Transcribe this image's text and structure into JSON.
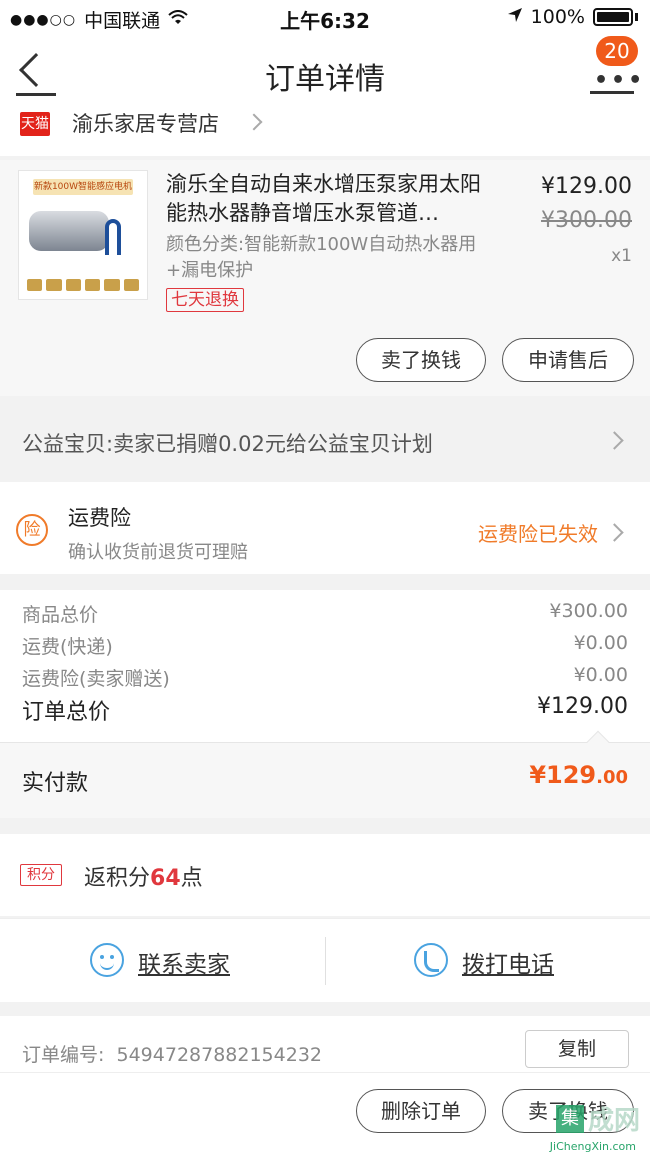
{
  "status_bar": {
    "carrier": "中国联通",
    "time": "上午6:32",
    "battery": "100%"
  },
  "nav": {
    "title": "订单详情",
    "badge": "20"
  },
  "store": {
    "badge": "天猫",
    "name": "渝乐家居专营店"
  },
  "product": {
    "title": "渝乐全自动自来水增压泵家用太阳能热水器静音增压水泵管道…",
    "sku": "颜色分类:智能新款100W自动热水器用+漏电保护",
    "tag": "七天退换",
    "price": "¥129.00",
    "original_price": "¥300.00",
    "quantity": "x1",
    "thumb_caption": "新款100W智能感应电机",
    "btn_sell": "卖了换钱",
    "btn_after_sale": "申请售后"
  },
  "charity": {
    "text": "公益宝贝:卖家已捐赠0.02元给公益宝贝计划"
  },
  "insurance": {
    "icon": "险",
    "title": "运费险",
    "subtitle": "确认收货前退货可理赔",
    "status": "运费险已失效"
  },
  "totals": {
    "rows": [
      {
        "label": "商品总价",
        "value": "¥300.00"
      },
      {
        "label": "运费(快递)",
        "value": "¥0.00"
      },
      {
        "label": "运费险(卖家赠送)",
        "value": "¥0.00"
      }
    ],
    "order_total_label": "订单总价",
    "order_total_value": "¥129.00",
    "paid_label": "实付款",
    "paid_main": "¥129",
    "paid_decimal": ".00"
  },
  "points": {
    "tag": "积分",
    "prefix": "返积分",
    "value": "64",
    "suffix": "点"
  },
  "contact": {
    "seller": "联系卖家",
    "phone": "拨打电话"
  },
  "order": {
    "number_label": "订单编号:",
    "number": "54947287882154232",
    "copy": "复制"
  },
  "actions": {
    "delete": "删除订单",
    "sell": "卖了换钱"
  },
  "watermark": {
    "box": "集",
    "text": "成网",
    "url": "JiChengXin.com"
  }
}
